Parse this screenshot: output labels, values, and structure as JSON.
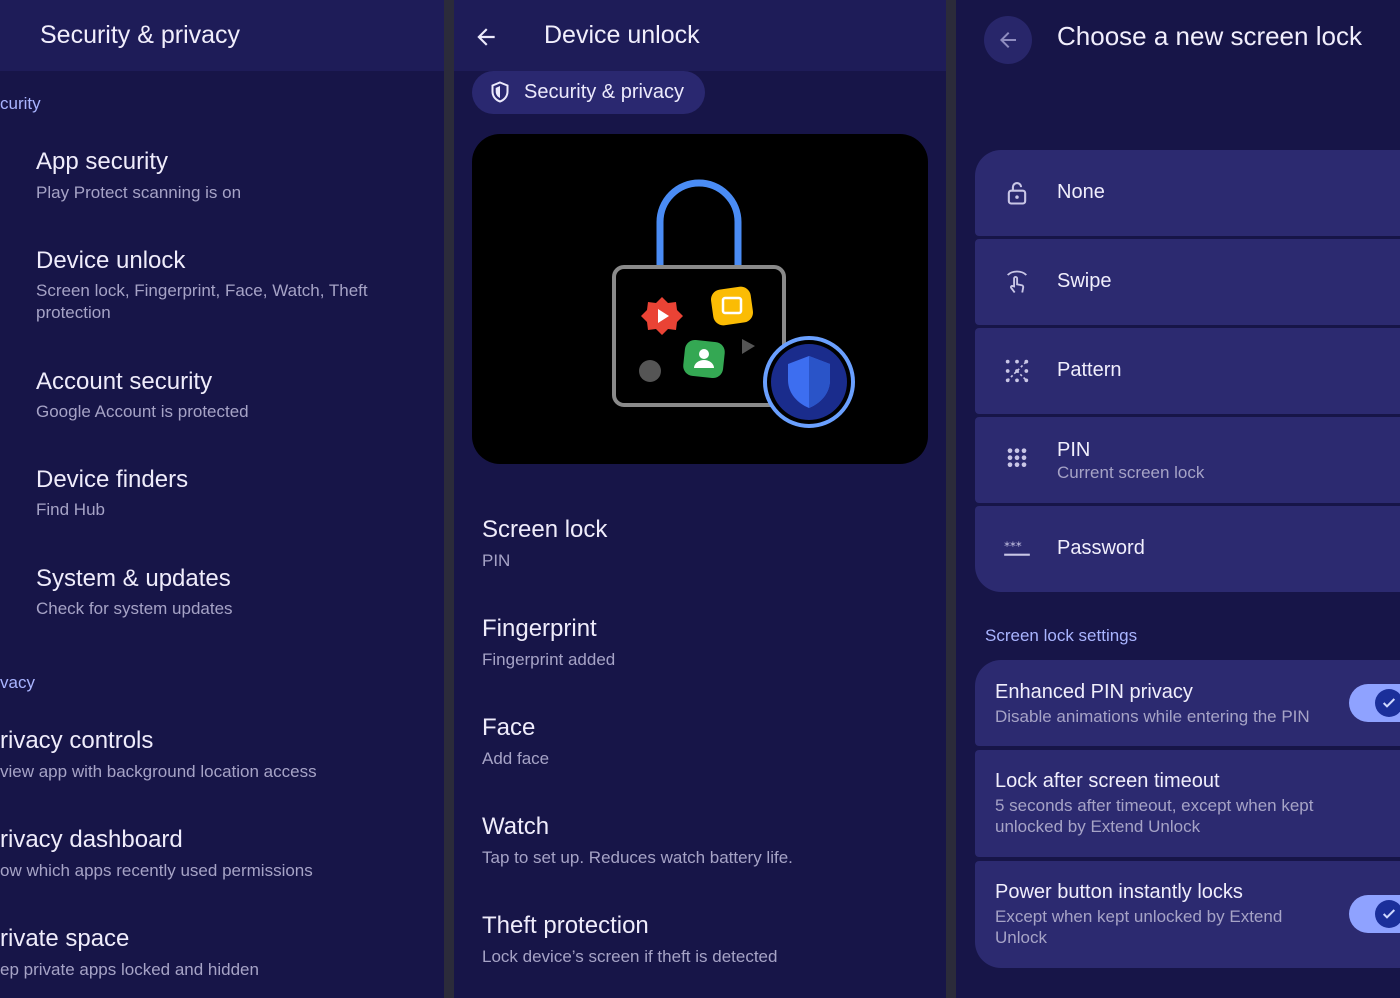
{
  "panel1": {
    "title": "Security & privacy",
    "section_security": "curity",
    "items": [
      {
        "title": "App security",
        "subtitle": "Play Protect scanning is on"
      },
      {
        "title": "Device unlock",
        "subtitle": "Screen lock, Fingerprint, Face, Watch, Theft protection"
      },
      {
        "title": "Account security",
        "subtitle": "Google Account is protected"
      },
      {
        "title": "Device finders",
        "subtitle": "Find Hub"
      },
      {
        "title": "System & updates",
        "subtitle": "Check for system updates"
      }
    ],
    "section_privacy": "vacy",
    "privacy_items": [
      {
        "title": "rivacy controls",
        "subtitle": "view app with background location access"
      },
      {
        "title": "rivacy dashboard",
        "subtitle": "ow which apps recently used permissions"
      },
      {
        "title": "rivate space",
        "subtitle": "ep private apps locked and hidden"
      }
    ]
  },
  "panel2": {
    "title": "Device unlock",
    "chip_label": "Security & privacy",
    "items": [
      {
        "title": "Screen lock",
        "subtitle": "PIN"
      },
      {
        "title": "Fingerprint",
        "subtitle": "Fingerprint added"
      },
      {
        "title": "Face",
        "subtitle": "Add face"
      },
      {
        "title": "Watch",
        "subtitle": "Tap to set up. Reduces watch battery life."
      },
      {
        "title": "Theft protection",
        "subtitle": "Lock device’s screen if theft is detected"
      }
    ]
  },
  "panel3": {
    "title": "Choose a new screen lock",
    "options": [
      {
        "label": "None",
        "icon": "unlocked-padlock-icon"
      },
      {
        "label": "Swipe",
        "icon": "swipe-gesture-icon"
      },
      {
        "label": "Pattern",
        "icon": "pattern-grid-icon"
      },
      {
        "label": "PIN",
        "subtitle": "Current screen lock",
        "icon": "pin-keypad-icon"
      },
      {
        "label": "Password",
        "icon": "password-asterisks-icon"
      }
    ],
    "settings_header": "Screen lock settings",
    "settings": [
      {
        "title": "Enhanced PIN privacy",
        "subtitle": "Disable animations while entering the PIN",
        "toggle": true
      },
      {
        "title": "Lock after screen timeout",
        "subtitle": "5 seconds after timeout, except when kept unlocked by Extend Unlock"
      },
      {
        "title": "Power button instantly locks",
        "subtitle": "Except when kept unlocked by Extend Unlock",
        "toggle": true
      }
    ]
  },
  "colors": {
    "background": "#171548",
    "topbar": "#1e1c58",
    "card": "#2c2a70",
    "accent": "#a9b4ff",
    "toggle_track": "#8fa2ff"
  }
}
